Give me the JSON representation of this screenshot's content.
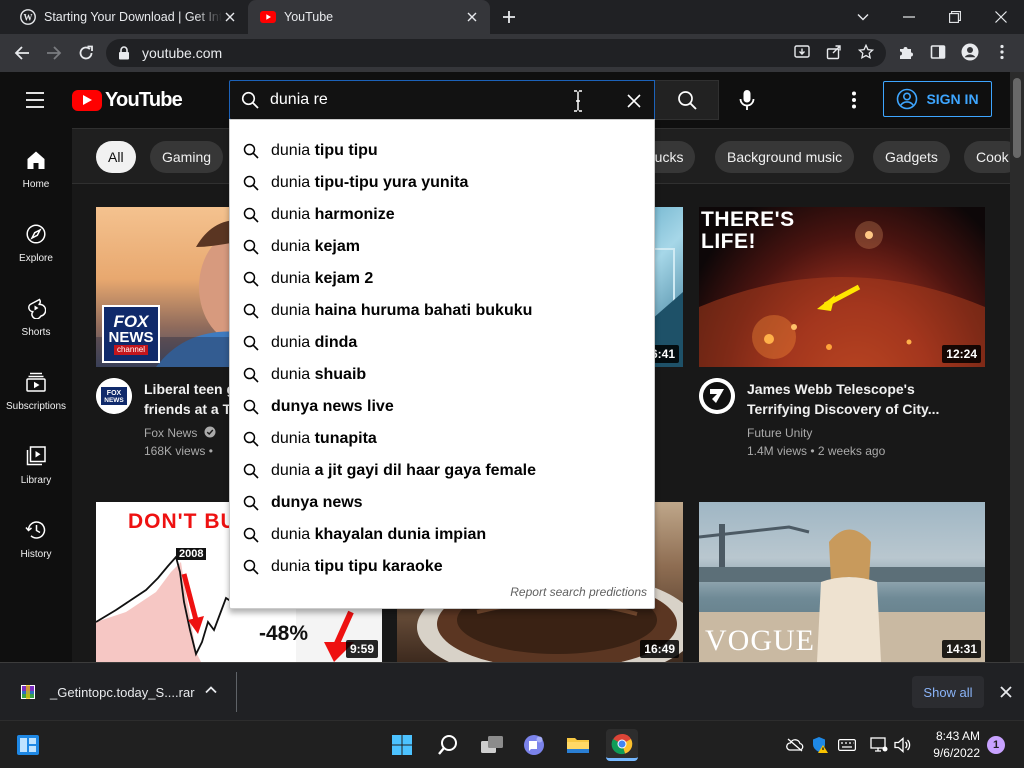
{
  "browser": {
    "tabs": [
      {
        "title": "Starting Your Download | Get Into PC",
        "icon": "wordpress-icon",
        "active": false
      },
      {
        "title": "YouTube",
        "icon": "youtube-icon",
        "active": true
      }
    ],
    "url": "youtube.com"
  },
  "youtube": {
    "logo_text": "YouTube",
    "search": {
      "query": "dunia re",
      "suggestions": [
        {
          "typed": "dunia ",
          "completion": "tipu tipu"
        },
        {
          "typed": "dunia ",
          "completion": "tipu-tipu yura yunita"
        },
        {
          "typed": "dunia ",
          "completion": "harmonize"
        },
        {
          "typed": "dunia ",
          "completion": "kejam"
        },
        {
          "typed": "dunia ",
          "completion": "kejam 2"
        },
        {
          "typed": "dunia ",
          "completion": "haina huruma bahati bukuku"
        },
        {
          "typed": "dunia ",
          "completion": "dinda"
        },
        {
          "typed": "dunia ",
          "completion": "shuaib"
        },
        {
          "typed": "dunya news live",
          "completion": ""
        },
        {
          "typed": "dunia ",
          "completion": "tunapita"
        },
        {
          "typed": "dunia ",
          "completion": "a jit gayi dil haar gaya female"
        },
        {
          "typed": "dunya news",
          "completion": ""
        },
        {
          "typed": "dunia ",
          "completion": "khayalan dunia impian"
        },
        {
          "typed": "dunia ",
          "completion": "tipu tipu karaoke"
        }
      ],
      "report_label": "Report search predictions"
    },
    "sign_in_label": "SIGN IN",
    "sidebar": [
      {
        "label": "Home",
        "icon": "home-icon"
      },
      {
        "label": "Explore",
        "icon": "compass-icon"
      },
      {
        "label": "Shorts",
        "icon": "shorts-icon"
      },
      {
        "label": "Subscriptions",
        "icon": "subscriptions-icon"
      },
      {
        "label": "Library",
        "icon": "library-icon"
      },
      {
        "label": "History",
        "icon": "history-icon"
      }
    ],
    "chips": [
      "All",
      "Gaming",
      "rucks",
      "Background music",
      "Gadgets",
      "Cook"
    ],
    "videos": [
      {
        "title_line1": "Liberal teen g",
        "title_line2": "friends at a Tr",
        "channel": "Fox News",
        "verified": true,
        "meta": "168K views •",
        "thumb_badge": "FOX NEWS channel"
      },
      {
        "duration": "6:41"
      },
      {
        "title_line1": "James Webb Telescope's",
        "title_line2": "Terrifying Discovery of City...",
        "channel": "Future Unity",
        "meta": "1.4M views • 2 weeks ago",
        "duration": "12:24",
        "thumb_text": "THERE'S LIFE!"
      },
      {
        "duration": "9:59",
        "thumb_text": "DON'T BU",
        "thumb_year": "2008",
        "thumb_pct": "-48%"
      },
      {
        "duration": "16:49"
      },
      {
        "duration": "14:31",
        "thumb_text": "VOGUE"
      }
    ]
  },
  "download_shelf": {
    "file": "_Getintopc.today_S....rar",
    "show_all": "Show all"
  },
  "taskbar": {
    "time": "8:43 AM",
    "date": "9/6/2022",
    "notification_count": "1"
  }
}
